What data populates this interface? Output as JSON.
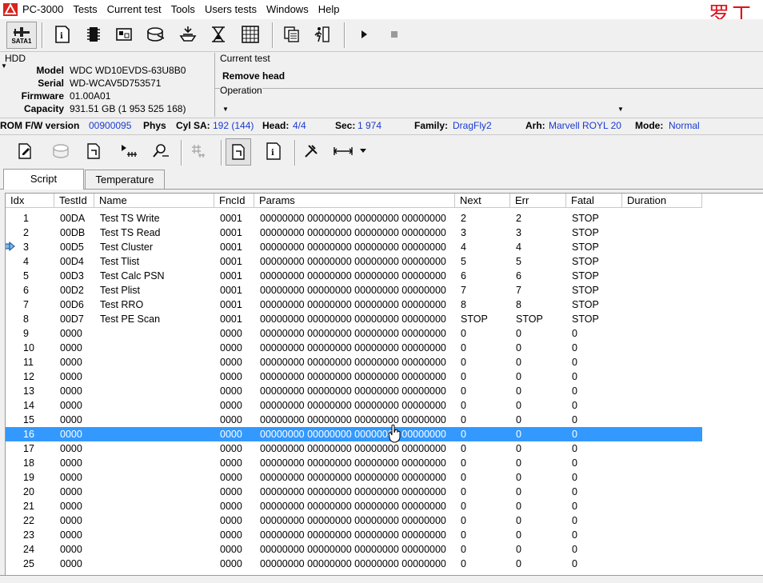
{
  "app": {
    "title": "PC-3000",
    "watermark": "罗工"
  },
  "menu": [
    "Tests",
    "Current test",
    "Tools",
    "Users tests",
    "Windows",
    "Help"
  ],
  "toolbar1": {
    "sata_label": "SATA1",
    "icons": [
      "passport-icon",
      "chip-icon",
      "board-icon",
      "drive-icon",
      "flash-icon",
      "hourglass-icon",
      "grid-icon",
      "copy-icon",
      "runner-icon",
      "play-icon",
      "stop-icon"
    ]
  },
  "hdd": {
    "legend": "HDD",
    "fields": [
      {
        "label": "Model",
        "value": "WDC WD10EVDS-63U8B0"
      },
      {
        "label": "Serial",
        "value": "WD-WCAV5D753571"
      },
      {
        "label": "Firmware",
        "value": "01.00A01"
      },
      {
        "label": "Capacity",
        "value": "931.51 GB (1 953 525 168)"
      }
    ]
  },
  "current_test": {
    "legend": "Current test",
    "name": "Remove head",
    "operation_legend": "Operation"
  },
  "status": {
    "rom_label": "ROM F/W version",
    "rom_value": "00900095",
    "phys_label": "Phys",
    "cyl_label": "Cyl SA:",
    "cyl_value": "192 (144)",
    "head_label": "Head:",
    "head_value": "4/4",
    "sec_label": "Sec:",
    "sec_value": "1 974",
    "family_label": "Family:",
    "family_value": "DragFly2",
    "arh_label": "Arh:",
    "arh_value": "Marvell ROYL 20",
    "mode_label": "Mode:",
    "mode_value": "Normal"
  },
  "tabs": [
    "Script",
    "Temperature"
  ],
  "table": {
    "columns": [
      "Idx",
      "TestId",
      "Name",
      "FncId",
      "Params",
      "Next",
      "Err",
      "Fatal",
      "Duration"
    ],
    "rows": [
      [
        "1",
        "00DA",
        "Test TS Write",
        "0001",
        "00000000 00000000 00000000 00000000",
        "2",
        "2",
        "STOP"
      ],
      [
        "2",
        "00DB",
        "Test TS Read",
        "0001",
        "00000000 00000000 00000000 00000000",
        "3",
        "3",
        "STOP"
      ],
      [
        "3",
        "00D5",
        "Test Cluster",
        "0001",
        "00000000 00000000 00000000 00000000",
        "4",
        "4",
        "STOP"
      ],
      [
        "4",
        "00D4",
        "Test Tlist",
        "0001",
        "00000000 00000000 00000000 00000000",
        "5",
        "5",
        "STOP"
      ],
      [
        "5",
        "00D3",
        "Test Calc PSN",
        "0001",
        "00000000 00000000 00000000 00000000",
        "6",
        "6",
        "STOP"
      ],
      [
        "6",
        "00D2",
        "Test Plist",
        "0001",
        "00000000 00000000 00000000 00000000",
        "7",
        "7",
        "STOP"
      ],
      [
        "7",
        "00D6",
        "Test RRO",
        "0001",
        "00000000 00000000 00000000 00000000",
        "8",
        "8",
        "STOP"
      ],
      [
        "8",
        "00D7",
        "Test PE Scan",
        "0001",
        "00000000 00000000 00000000 00000000",
        "STOP",
        "STOP",
        "STOP"
      ],
      [
        "9",
        "0000",
        "",
        "0000",
        "00000000 00000000 00000000 00000000",
        "0",
        "0",
        "0"
      ],
      [
        "10",
        "0000",
        "",
        "0000",
        "00000000 00000000 00000000 00000000",
        "0",
        "0",
        "0"
      ],
      [
        "11",
        "0000",
        "",
        "0000",
        "00000000 00000000 00000000 00000000",
        "0",
        "0",
        "0"
      ],
      [
        "12",
        "0000",
        "",
        "0000",
        "00000000 00000000 00000000 00000000",
        "0",
        "0",
        "0"
      ],
      [
        "13",
        "0000",
        "",
        "0000",
        "00000000 00000000 00000000 00000000",
        "0",
        "0",
        "0"
      ],
      [
        "14",
        "0000",
        "",
        "0000",
        "00000000 00000000 00000000 00000000",
        "0",
        "0",
        "0"
      ],
      [
        "15",
        "0000",
        "",
        "0000",
        "00000000 00000000 00000000 00000000",
        "0",
        "0",
        "0"
      ],
      [
        "16",
        "0000",
        "",
        "0000",
        "00000000 00000000 00000000 00000000",
        "0",
        "0",
        "0"
      ],
      [
        "17",
        "0000",
        "",
        "0000",
        "00000000 00000000 00000000 00000000",
        "0",
        "0",
        "0"
      ],
      [
        "18",
        "0000",
        "",
        "0000",
        "00000000 00000000 00000000 00000000",
        "0",
        "0",
        "0"
      ],
      [
        "19",
        "0000",
        "",
        "0000",
        "00000000 00000000 00000000 00000000",
        "0",
        "0",
        "0"
      ],
      [
        "20",
        "0000",
        "",
        "0000",
        "00000000 00000000 00000000 00000000",
        "0",
        "0",
        "0"
      ],
      [
        "21",
        "0000",
        "",
        "0000",
        "00000000 00000000 00000000 00000000",
        "0",
        "0",
        "0"
      ],
      [
        "22",
        "0000",
        "",
        "0000",
        "00000000 00000000 00000000 00000000",
        "0",
        "0",
        "0"
      ],
      [
        "23",
        "0000",
        "",
        "0000",
        "00000000 00000000 00000000 00000000",
        "0",
        "0",
        "0"
      ],
      [
        "24",
        "0000",
        "",
        "0000",
        "00000000 00000000 00000000 00000000",
        "0",
        "0",
        "0"
      ],
      [
        "25",
        "0000",
        "",
        "0000",
        "00000000 00000000 00000000 00000000",
        "0",
        "0",
        "0"
      ]
    ],
    "selected_row": "16",
    "current_row": "3"
  },
  "colors": {
    "selection": "#3399ff",
    "status_value": "#1a3ad0",
    "watermark": "#e0101a"
  }
}
